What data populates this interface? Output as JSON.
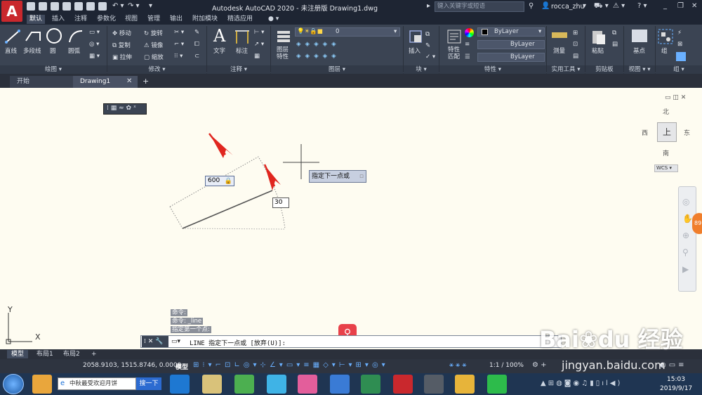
{
  "titlebar": {
    "title": "Autodesk AutoCAD 2020 - 未注册版    Drawing1.dwg",
    "search_placeholder": "键入关键字或短语",
    "user": "rocca_zhu"
  },
  "menu_tabs": [
    "默认",
    "插入",
    "注释",
    "参数化",
    "视图",
    "管理",
    "输出",
    "附加模块",
    "精选应用"
  ],
  "ribbon": {
    "draw": {
      "line": "直线",
      "polyline": "多段线",
      "circle": "圆",
      "arc": "圆弧",
      "title": "绘图"
    },
    "modify": {
      "move": "移动",
      "rotate": "旋转",
      "copy": "复制",
      "mirror": "镜像",
      "stretch": "拉伸",
      "scale": "缩放",
      "title": "修改"
    },
    "annotation": {
      "text": "文字",
      "dimension": "标注",
      "title": "注释"
    },
    "layers": {
      "layer_props": "图层\n特性",
      "current_layer": "0",
      "title": "图层"
    },
    "block": {
      "insert": "插入",
      "title": "块"
    },
    "properties": {
      "match": "特性\n匹配",
      "color": "ByLayer",
      "linetype": "ByLayer",
      "lineweight": "ByLayer",
      "title": "特性"
    },
    "utilities": {
      "measure": "测量",
      "title": "实用工具"
    },
    "clipboard": {
      "paste": "粘贴",
      "title": "剪贴板"
    },
    "view": {
      "base": "基点",
      "title": "视图"
    },
    "groups": {
      "group": "组",
      "title": "组"
    }
  },
  "doc_tabs": {
    "start": "开始",
    "drawing": "Drawing1"
  },
  "canvas": {
    "dim_length": "600",
    "dim_angle": "30",
    "tooltip": "指定下一点或",
    "viewcube": {
      "north": "北",
      "south": "南",
      "east": "东",
      "west": "西",
      "top": "上",
      "wcs": "WCS"
    },
    "nav_badge": "89",
    "axis_x": "X",
    "axis_y": "Y"
  },
  "command": {
    "history": [
      "命令:",
      "命令:  _line",
      "指定第一个点:"
    ],
    "prompt": "LINE 指定下一点或 [放弃(U)]:"
  },
  "layout_tabs": [
    "模型",
    "布局1",
    "布局2"
  ],
  "status": {
    "coords": "2058.9103, 1515.8746, 0.0000",
    "model": "模型",
    "scale": "1:1 / 100%"
  },
  "taskbar": {
    "browser_tab": "中秋最受欢迎月饼",
    "search_btn": "搜一下",
    "time": "15:03",
    "date": "2019/9/17"
  },
  "watermark": {
    "brand": "Bai du 经验",
    "url": "jingyan.baidu.com"
  }
}
